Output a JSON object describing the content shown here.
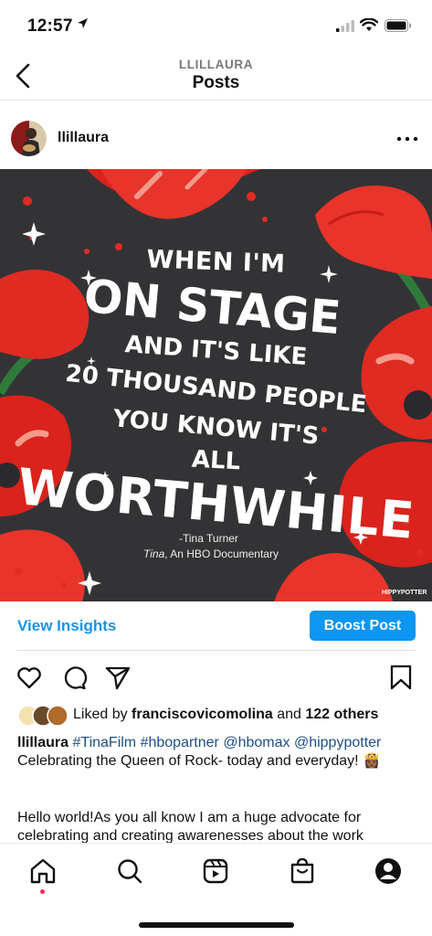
{
  "status_bar": {
    "time": "12:57"
  },
  "header": {
    "subtitle": "LLILLAURA",
    "title": "Posts"
  },
  "post": {
    "username": "llillaura",
    "image": {
      "quote_lines": [
        "WHEN I'M",
        "ON STAGE",
        "AND IT'S LIKE",
        "20 THOUSAND PEOPLE",
        "YOU KNOW IT'S",
        "ALL",
        "WORTHWHILE"
      ],
      "attribution": "-Tina Turner",
      "attribution_title": "Tina",
      "attribution_suffix": ", An HBO Documentary",
      "watermark": "HIPPYPOTTER"
    },
    "insights_label": "View Insights",
    "boost_label": "Boost Post",
    "likes": {
      "prefix": "Liked by ",
      "user": "franciscovicomolina",
      "middle": " and ",
      "others": "122 others"
    },
    "caption": {
      "username": "llillaura",
      "tags": [
        "#TinaFilm",
        "#hbopartner",
        "@hbomax",
        "@hippypotter"
      ],
      "text": " Celebrating the Queen of Rock- today and everyday! 👸🏾",
      "body": "Hello world!As you all know I am a huge advocate for celebrating and creating awarenesses about the work"
    }
  },
  "colors": {
    "accent": "#0d96f2",
    "link": "#1a94e8",
    "tag": "#1f4f86",
    "background_image": "#333336",
    "poppy": "#e3261e"
  }
}
